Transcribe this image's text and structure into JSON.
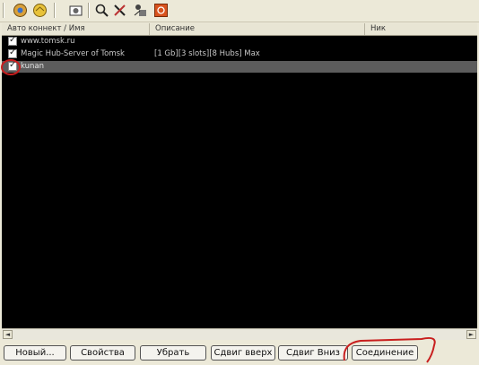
{
  "toolbar": {
    "icons": [
      "connect-icon",
      "favorites-icon",
      "settings-icon",
      "search-icon",
      "tools-icon",
      "network-icon",
      "stop-icon"
    ]
  },
  "columns": {
    "name": "Авто коннект / Имя",
    "description": "Описание",
    "nick": "Ник"
  },
  "rows": [
    {
      "name": "www.tomsk.ru",
      "description": "",
      "checked": true
    },
    {
      "name": "Magic Hub-Server of Tomsk",
      "description": "[1 Gb][3 slots][8 Hubs] Max",
      "checked": true
    },
    {
      "name": "kunan",
      "description": "",
      "checked": true
    }
  ],
  "buttons": {
    "new": "Новый...",
    "properties": "Свойства",
    "remove": "Убрать",
    "move_up": "Сдвиг вверх",
    "move_down": "Сдвиг Вниз",
    "connect": "Соединение"
  },
  "colors": {
    "background": "#ece9d8",
    "list_background": "#000000",
    "selected_row": "#5c5c5c",
    "annotation": "#c81e1e"
  }
}
